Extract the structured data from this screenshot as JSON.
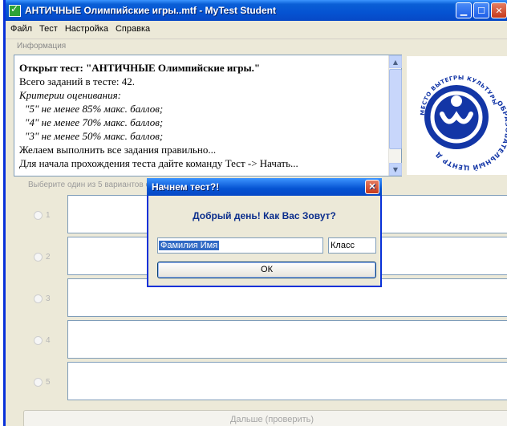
{
  "window": {
    "title": "АНТИЧНЫЕ Олимпийские игры..mtf - MyTest Student"
  },
  "menu": [
    "Файл",
    "Тест",
    "Настройка",
    "Справка"
  ],
  "info_tab_label": "Информация",
  "info": {
    "opened_prefix": "Открыт тест: ",
    "opened_name": "\"АНТИЧНЫЕ Олимпийские игры.\"",
    "total": "Всего заданий в тесте: 42.",
    "criteria_title": "Критерии оценивания:",
    "criteria": [
      "\"5\" не менее 85% макс. баллов;",
      "\"4\" не менее 70% макс. баллов;",
      "\"3\" не менее 50% макс. баллов;"
    ],
    "wish": "Желаем выполнить все задания правильно...",
    "instruction": "Для начала прохождения теста дайте команду Тест -> Начать..."
  },
  "logo": {
    "top_text": "МЕСТО ВЫТЕГРЫ КУЛЬТУРЫ",
    "side_text": "ОБРАЗОВАТЕЛЬНЫЙ ЦЕНТР ДНИ",
    "color": "#1336a6"
  },
  "hint": "Выберите один из 5 вариантов о",
  "answers": [
    "1",
    "2",
    "3",
    "4",
    "5"
  ],
  "next_button": "Дальше (проверить)",
  "dialog": {
    "title": "Начнем тест?!",
    "greeting": "Добрый день! Как Вас Зовут?",
    "name_value": "Фамилия Имя",
    "class_value": "Класс",
    "ok_label": "ОК"
  }
}
